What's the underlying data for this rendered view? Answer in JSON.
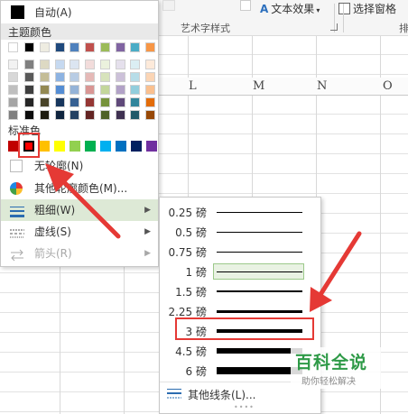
{
  "ribbon": {
    "art_effect_label": "文本效果",
    "select_pane_label": "选择窗格",
    "art_group_label": "艺术字样式",
    "right_group_label": "排"
  },
  "columns": [
    "L",
    "M",
    "N",
    "O"
  ],
  "menu": {
    "auto_label": "自动(A)",
    "theme_colors_label": "主题颜色",
    "standard_colors_label": "标准色",
    "no_outline_label": "无轮廓(N)",
    "more_colors_label": "其他轮廓颜色(M)...",
    "weight_label": "粗细(W)",
    "dash_label": "虚线(S)",
    "arrow_label": "箭头(R)"
  },
  "theme_palette": [
    [
      "#ffffff",
      "#000000",
      "#eeece1",
      "#1f497d",
      "#4f81bd",
      "#c0504d",
      "#9bbb59",
      "#8064a2",
      "#4bacc6",
      "#f79646",
      "#92d050"
    ],
    [
      "#f2f2f2",
      "#7f7f7f",
      "#ddd9c3",
      "#c6d9f0",
      "#dbe5f1",
      "#f2dcdb",
      "#ebf1dd",
      "#e5e0ec",
      "#dbeef3",
      "#fdeada",
      "#e2f0d9"
    ],
    [
      "#d8d8d8",
      "#595959",
      "#c4bd97",
      "#8db3e2",
      "#b8cce4",
      "#e5b9b7",
      "#d7e3bc",
      "#ccc1d9",
      "#b7dde8",
      "#fbd5b5",
      "#c5e0b3"
    ],
    [
      "#bfbfbf",
      "#3f3f3f",
      "#938953",
      "#548dd4",
      "#95b3d7",
      "#d99694",
      "#c3d69b",
      "#b2a2c7",
      "#92cddc",
      "#fac08f",
      "#a9d18e"
    ],
    [
      "#a5a5a5",
      "#262626",
      "#494429",
      "#17365d",
      "#366092",
      "#953734",
      "#76923c",
      "#5f497a",
      "#31859b",
      "#e36c09",
      "#70ad47"
    ],
    [
      "#7f7f7f",
      "#0c0c0c",
      "#1d1b10",
      "#0f243e",
      "#244061",
      "#632423",
      "#4f6128",
      "#3f3151",
      "#205867",
      "#974806",
      "#548235"
    ]
  ],
  "standard_colors": [
    "#c00000",
    "#ff0000",
    "#ffc000",
    "#ffff00",
    "#92d050",
    "#00b050",
    "#00b0f0",
    "#0070c0",
    "#002060",
    "#7030a0"
  ],
  "weights": [
    {
      "label": "0.25 磅",
      "pt": 0.25
    },
    {
      "label": "0.5 磅",
      "pt": 0.5
    },
    {
      "label": "0.75 磅",
      "pt": 0.75
    },
    {
      "label": "1 磅",
      "pt": 1
    },
    {
      "label": "1.5 磅",
      "pt": 1.5
    },
    {
      "label": "2.25 磅",
      "pt": 2.25
    },
    {
      "label": "3 磅",
      "pt": 3
    },
    {
      "label": "4.5 磅",
      "pt": 4.5
    },
    {
      "label": "6 磅",
      "pt": 6
    }
  ],
  "selected_weight": "1 磅",
  "more_lines_label": "其他线条(L)...",
  "watermark": {
    "title": "百科全说",
    "subtitle": "助你轻松解决"
  },
  "colors": {
    "accent_red": "#e53935",
    "hover_green": "#dde9d6",
    "brand_green": "#2e9a47"
  }
}
